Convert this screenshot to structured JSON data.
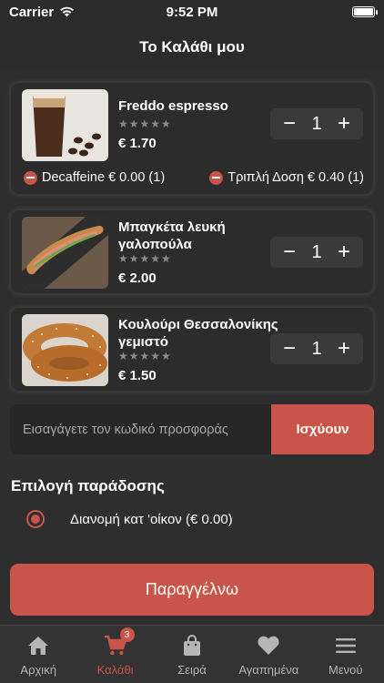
{
  "status_bar": {
    "carrier": "Carrier",
    "time": "9:52 PM"
  },
  "header": {
    "title": "Το Καλάθι μου"
  },
  "cart": {
    "items": [
      {
        "name": "Freddo espresso",
        "stars": "★★★★★",
        "price": "€ 1.70",
        "quantity": "1",
        "extras": [
          {
            "label": "Decaffeine € 0.00 (1)"
          },
          {
            "label": "Τριπλή Δοση € 0.40 (1)"
          }
        ]
      },
      {
        "name": "Μπαγκέτα λευκή γαλοπούλα",
        "stars": "★★★★★",
        "price": "€ 2.00",
        "quantity": "1"
      },
      {
        "name": "Κουλούρι Θεσσαλονίκης γεμιστό",
        "stars": "★★★★★",
        "price": "€ 1.50",
        "quantity": "1"
      }
    ],
    "stepper": {
      "minus": "−",
      "plus": "+"
    }
  },
  "promo": {
    "placeholder": "Εισαγάγετε τον κωδικό προσφοράς",
    "apply_label": "Ισχύουν"
  },
  "delivery": {
    "title": "Επιλογή παράδοσης",
    "option_label": "Διανομή κατ 'οίκον  (€ 0.00)"
  },
  "order_button": {
    "label": "Παραγγέλνω"
  },
  "tabbar": {
    "cart_badge": "3",
    "tabs": [
      {
        "label": "Αρχική",
        "icon": "home-icon"
      },
      {
        "label": "Καλάθι",
        "icon": "cart-icon"
      },
      {
        "label": "Σειρά",
        "icon": "bag-icon"
      },
      {
        "label": "Αγαπημένα",
        "icon": "heart-icon"
      },
      {
        "label": "Μενού",
        "icon": "menu-icon"
      }
    ]
  },
  "colors": {
    "accent": "#c9544a",
    "background": "#2a2a2a",
    "card": "#2c2c2c"
  }
}
